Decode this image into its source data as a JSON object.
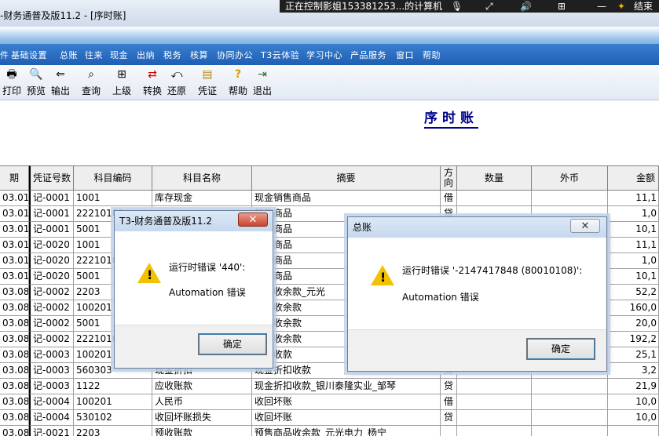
{
  "window": {
    "title": "-财务通普及版11.2 - [序时账]"
  },
  "remote_bar": {
    "text": "正在控制影姐153381253...的计算机",
    "end_label": "结束",
    "icons": [
      "microphone-icon",
      "expand-icon",
      "speaker-icon",
      "add-window-icon",
      "line-icon",
      "pin-icon"
    ]
  },
  "menu": {
    "items": [
      "件",
      "基础设置",
      "总账",
      "往来",
      "现金",
      "出纳",
      "税务",
      "核算",
      "协同办公",
      "T3云体验",
      "学习中心",
      "产品服务",
      "窗口",
      "帮助"
    ]
  },
  "toolbar": {
    "items": [
      {
        "label": "打印",
        "icon": "printer-icon",
        "glyph": "🖶"
      },
      {
        "label": "预览",
        "icon": "preview-icon",
        "glyph": "🔍"
      },
      {
        "label": "输出",
        "icon": "export-icon",
        "glyph": "⇐"
      },
      {
        "label": "查询",
        "icon": "binoculars-icon",
        "glyph": "⌕"
      },
      {
        "label": "上级",
        "icon": "tree-up-icon",
        "glyph": "⊞"
      },
      {
        "label": "转换",
        "icon": "convert-icon",
        "glyph": "⇄"
      },
      {
        "label": "还原",
        "icon": "restore-icon",
        "glyph": "⤺"
      },
      {
        "label": "凭证",
        "icon": "voucher-icon",
        "glyph": "▤"
      },
      {
        "label": "帮助",
        "icon": "help-icon",
        "glyph": "?"
      },
      {
        "label": "退出",
        "icon": "exit-icon",
        "glyph": "⇥"
      }
    ]
  },
  "report": {
    "title": "序时账"
  },
  "table": {
    "headers": [
      "期",
      "凭证号数",
      "科目编码",
      "科目名称",
      "摘要",
      "方向",
      "数量",
      "外币",
      "金额"
    ],
    "rows": [
      [
        "03.01",
        "记-0001",
        "1001",
        "库存现金",
        "现金销售商品",
        "借",
        "",
        "",
        "11,1"
      ],
      [
        "03.01",
        "记-0001",
        "22210101",
        "",
        "销售商品",
        "贷",
        "",
        "",
        "1,0"
      ],
      [
        "03.01",
        "记-0001",
        "5001",
        "",
        "销售商品",
        "",
        "",
        "",
        "10,1"
      ],
      [
        "03.01",
        "记-0020",
        "1001",
        "",
        "销售商品",
        "",
        "",
        "",
        "11,1"
      ],
      [
        "03.01",
        "记-0020",
        "22210101",
        "",
        "销售商品",
        "",
        "",
        "",
        "1,0"
      ],
      [
        "03.01",
        "记-0020",
        "5001",
        "",
        "销售商品",
        "",
        "",
        "",
        "10,1"
      ],
      [
        "03.08",
        "记-0002",
        "2203",
        "",
        "商品收余款_元光",
        "",
        "",
        "",
        "52,2"
      ],
      [
        "03.08",
        "记-0002",
        "100201",
        "",
        "商品收余款",
        "",
        "",
        "",
        "160,0"
      ],
      [
        "03.08",
        "记-0002",
        "5001",
        "",
        "商品收余款",
        "",
        "",
        "",
        "20,0"
      ],
      [
        "03.08",
        "记-0002",
        "22210101",
        "",
        "商品收余款",
        "",
        "",
        "",
        "192,2"
      ],
      [
        "03.08",
        "记-0003",
        "100201",
        "",
        "折扣收款",
        "",
        "",
        "",
        "25,1"
      ],
      [
        "03.08",
        "记-0003",
        "560303",
        "现金折扣",
        "现金折扣收款",
        "贷",
        "",
        "",
        "3,2"
      ],
      [
        "03.08",
        "记-0003",
        "1122",
        "应收账款",
        "现金折扣收款_银川泰隆实业_邹琴",
        "贷",
        "",
        "",
        "21,9"
      ],
      [
        "03.08",
        "记-0004",
        "100201",
        "人民币",
        "收回坏账",
        "借",
        "",
        "",
        "10,0"
      ],
      [
        "03.08",
        "记-0004",
        "530102",
        "收回坏账损失",
        "收回坏账",
        "贷",
        "",
        "",
        "10,0"
      ],
      [
        "03.08",
        "记-0021",
        "2203",
        "预收账款",
        "预售商品收余款_元光电力_杨宁",
        "",
        "",
        "",
        ""
      ]
    ]
  },
  "dialogs": [
    {
      "title": "T3-财务通普及版11.2",
      "message": "运行时错误 '440':",
      "sub": "Automation 错误",
      "button": "确定"
    },
    {
      "title": "总账",
      "message": "运行时错误 '-2147417848 (80010108)':",
      "sub": "Automation 错误",
      "button": "确定"
    }
  ],
  "colors": {
    "menu_bg": "#1f5fb5",
    "title_link": "#000088",
    "warning": "#f2c200"
  }
}
